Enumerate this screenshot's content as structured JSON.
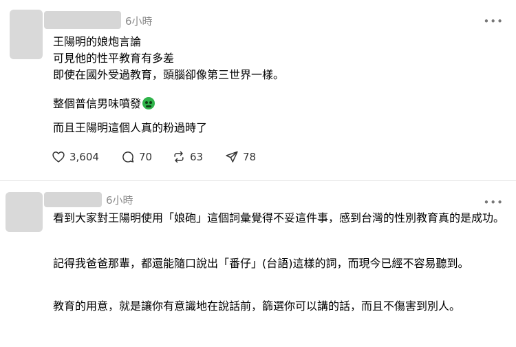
{
  "post1": {
    "time": "6小時",
    "lines": [
      "王陽明的娘炮言論",
      "可見他的性平教育有多差",
      "即使在國外受過教育，頭腦卻像第三世界一樣。",
      "整個普信男味噴發",
      "而且王陽明這個人真的粉過時了"
    ],
    "emoji_icon": "nauseated-face-icon",
    "actions": {
      "likes": "3,604",
      "comments": "70",
      "reposts": "63",
      "shares": "78"
    }
  },
  "post2": {
    "time": "6小時",
    "paragraphs": [
      "看到大家對王陽明使用「娘砲」這個詞彙覺得不妥這件事，感到台灣的性別教育真的是成功。",
      "記得我爸爸那輩，都還能隨口說出「番仔」(台語)這樣的詞，而現今已經不容易聽到。",
      "教育的用意，就是讓你有意識地在說話前，篩選你可以講的話，而且不傷害到別人。"
    ]
  },
  "colors": {
    "background": "#ffffff",
    "text": "#000000",
    "muted": "#8a8a8a",
    "divider": "#e6e6e6",
    "emoji": "#2fb34a"
  }
}
